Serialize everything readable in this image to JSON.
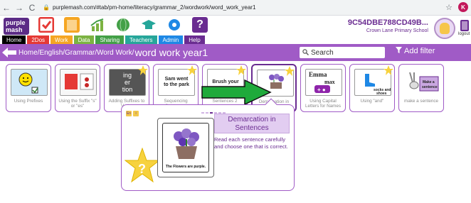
{
  "browser": {
    "url": "purplemash.com/#tab/pm-home/literacy/grammar_2/wordwork/word_work_year1",
    "profile_initial": "K"
  },
  "header": {
    "logo_line1": "purple",
    "logo_line2": "mash",
    "nav": [
      {
        "label": "Home",
        "color": "#000000"
      },
      {
        "label": "2Dos",
        "color": "#e53935"
      },
      {
        "label": "Work",
        "color": "#f5a623"
      },
      {
        "label": "Data",
        "color": "#7cb342"
      },
      {
        "label": "Sharing",
        "color": "#43a047"
      },
      {
        "label": "Teachers",
        "color": "#26a69a"
      },
      {
        "label": "Admin",
        "color": "#1e88e5"
      },
      {
        "label": "Help",
        "color": "#6a2c91"
      }
    ],
    "account_id": "9C54DBE788CD49B...",
    "school": "Crown Lane Primary School",
    "logout_label": "logout"
  },
  "breadcrumb": {
    "path": "Home/English/Grammar/Word Work/",
    "title": "word work year1",
    "search_placeholder": "Search",
    "filter_label": "Add filter"
  },
  "cards": [
    {
      "label": "Using Prefixes",
      "thumb": "Quiz"
    },
    {
      "label": "Using the Suffix \"s\" or \"es\"",
      "thumb": ""
    },
    {
      "label": "Adding Suffixes to Verbs",
      "thumb": "ing er tion"
    },
    {
      "label": "Sequencing Sentences",
      "thumb": "Sam went to the park"
    },
    {
      "label": "Sentences 2",
      "thumb": "Brush your"
    },
    {
      "label": "Demarcation in Sentences",
      "thumb": "The Flowers are purple"
    },
    {
      "label": "Using Capital Letters for Names",
      "thumb": "Emma max"
    },
    {
      "label": "Using \"and\"",
      "thumb": "socks and shoes"
    },
    {
      "label": "make a sentence",
      "thumb": "Make a sentence"
    }
  ],
  "detail": {
    "title": "Demarcation in Sentences",
    "description": "Read each sentence carefully and choose one that is correct.",
    "caption": "The Flowers are purple."
  },
  "colors": {
    "accent": "#a05bc6",
    "brand": "#6a2c91",
    "arrow": "#1faa3b"
  }
}
